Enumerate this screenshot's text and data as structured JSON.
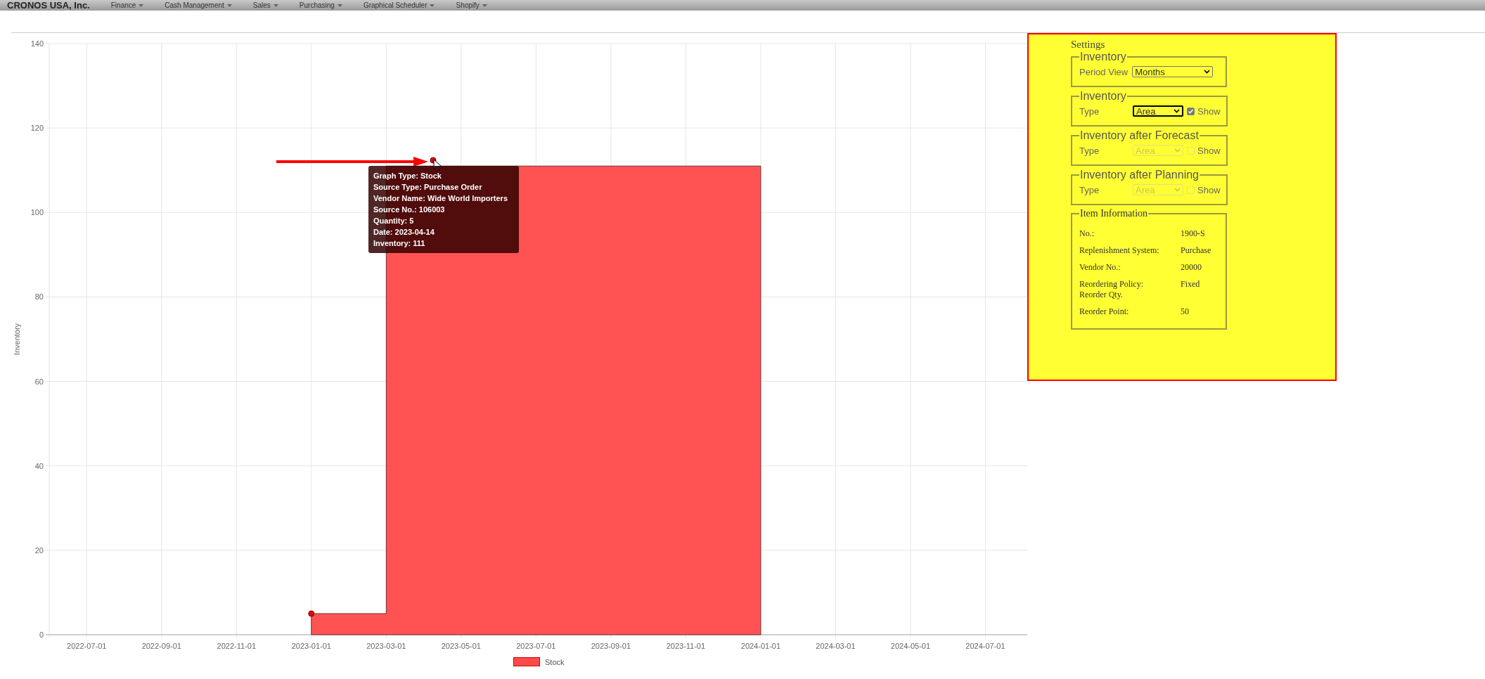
{
  "top_bar": {
    "company": "CRONOS USA, Inc.",
    "menu": [
      "Finance",
      "Cash Management",
      "Sales",
      "Purchasing",
      "Graphical Scheduler",
      "Shopify"
    ]
  },
  "chart": {
    "chart_data": {
      "type": "area",
      "grid": true,
      "ylabel": "Inventory",
      "ylim": [
        0,
        140
      ],
      "yticks": [
        0,
        20,
        40,
        60,
        80,
        100,
        120,
        140
      ],
      "categories": [
        "2022-07-01",
        "2022-09-01",
        "2022-11-01",
        "2023-01-01",
        "2023-03-01",
        "2023-05-01",
        "2023-07-01",
        "2023-09-01",
        "2023-11-01",
        "2024-01-01",
        "2024-03-01",
        "2024-05-01",
        "2024-07-01"
      ],
      "series": [
        {
          "name": "Stock",
          "color": "#ff4a4a",
          "values": [
            null,
            null,
            null,
            5,
            111,
            111,
            111,
            111,
            111,
            0,
            null,
            null,
            null
          ]
        }
      ]
    },
    "tooltip": [
      "Graph Type: Stock",
      "Source Type: Purchase Order",
      "Vendor Name: Wide World Importers",
      "Source No.: 106003",
      "Quantity: 5",
      "Date: 2023-04-14",
      "Inventory: 111"
    ]
  },
  "settings": {
    "title": "Settings",
    "groups": [
      {
        "kind": "period",
        "legend": "Inventory",
        "label": "Period View",
        "value": "Months",
        "disabled": false
      },
      {
        "kind": "type",
        "legend": "Inventory",
        "label": "Type",
        "value": "Area",
        "disabled": false,
        "focused": true,
        "show_label": "Show",
        "checked": true
      },
      {
        "kind": "type",
        "legend": "Inventory after Forecast",
        "label": "Type",
        "value": "Area",
        "disabled": true,
        "focused": false,
        "show_label": "Show",
        "checked": false
      },
      {
        "kind": "type",
        "legend": "Inventory after Planning",
        "label": "Type",
        "value": "Area",
        "disabled": true,
        "focused": false,
        "show_label": "Show",
        "checked": false
      }
    ],
    "item_info": {
      "legend": "Item Information",
      "rows": [
        {
          "label": "No.:",
          "value": "1900-S"
        },
        {
          "label": "Replenishment System:",
          "value": "Purchase"
        },
        {
          "label": "Vendor No.:",
          "value": "20000"
        },
        {
          "label": "Reordering Policy:",
          "value": "Fixed",
          "note": "Reorder Qty."
        },
        {
          "label": "Reorder Point:",
          "value": "50"
        }
      ]
    }
  }
}
